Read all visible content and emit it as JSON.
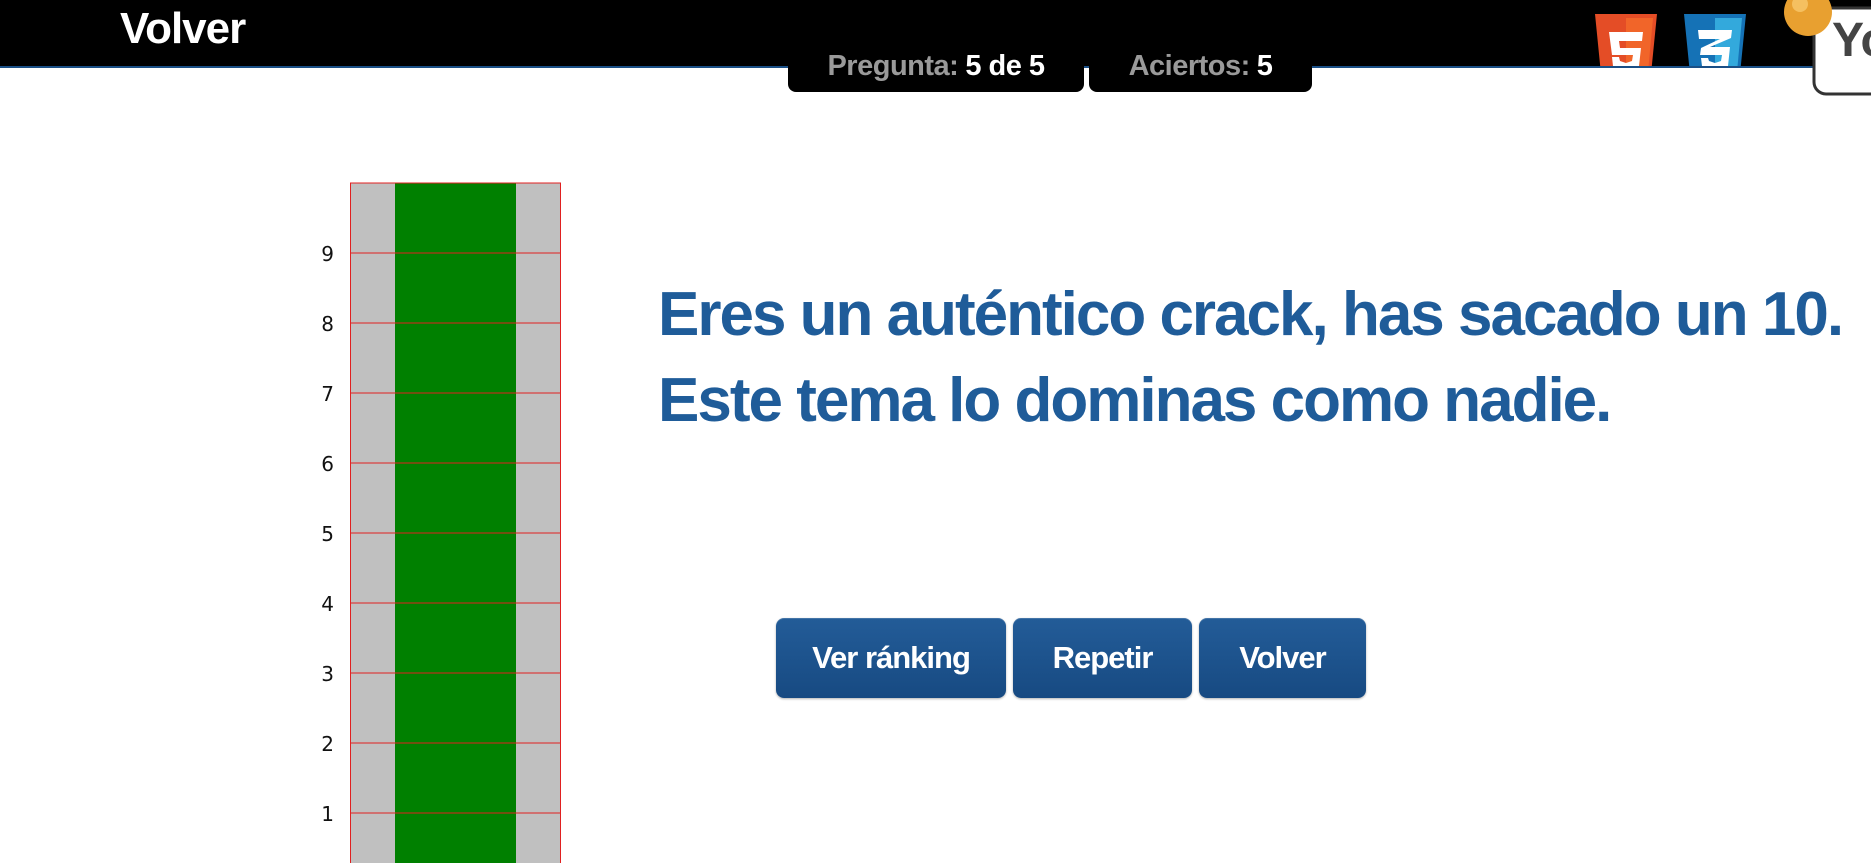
{
  "header": {
    "back_label": "Volver",
    "question_label": "Pregunta:",
    "question_value": "5 de 5",
    "hits_label": "Aciertos:",
    "hits_value": "5"
  },
  "logos": [
    {
      "icon": "html5-logo-icon",
      "color": "#e44d26"
    },
    {
      "icon": "css3-logo-icon",
      "color": "#1572b6"
    },
    {
      "icon": "site-logo-icon",
      "color": "#f0a030"
    }
  ],
  "result": {
    "message": "Eres un auténtico crack, has sacado un 10. Este tema lo dominas como nadie."
  },
  "actions": {
    "ranking_label": "Ver ránking",
    "repeat_label": "Repetir",
    "back_label": "Volver"
  },
  "chart_data": {
    "type": "bar",
    "categories": [
      ""
    ],
    "values": [
      10
    ],
    "ylim": [
      0,
      10
    ],
    "yticks": [
      "1",
      "2",
      "3",
      "4",
      "5",
      "6",
      "7",
      "8",
      "9"
    ],
    "grid": true,
    "colors": {
      "bar": "#008000",
      "background": "#c0c0c0",
      "grid": "#e02020",
      "axis_text": "#111111"
    }
  }
}
